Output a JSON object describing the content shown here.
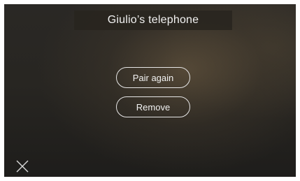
{
  "header": {
    "title": "Giulio’s telephone"
  },
  "actions": {
    "pair_again_label": "Pair again",
    "remove_label": "Remove"
  },
  "footer": {
    "close_icon": "close-icon"
  }
}
